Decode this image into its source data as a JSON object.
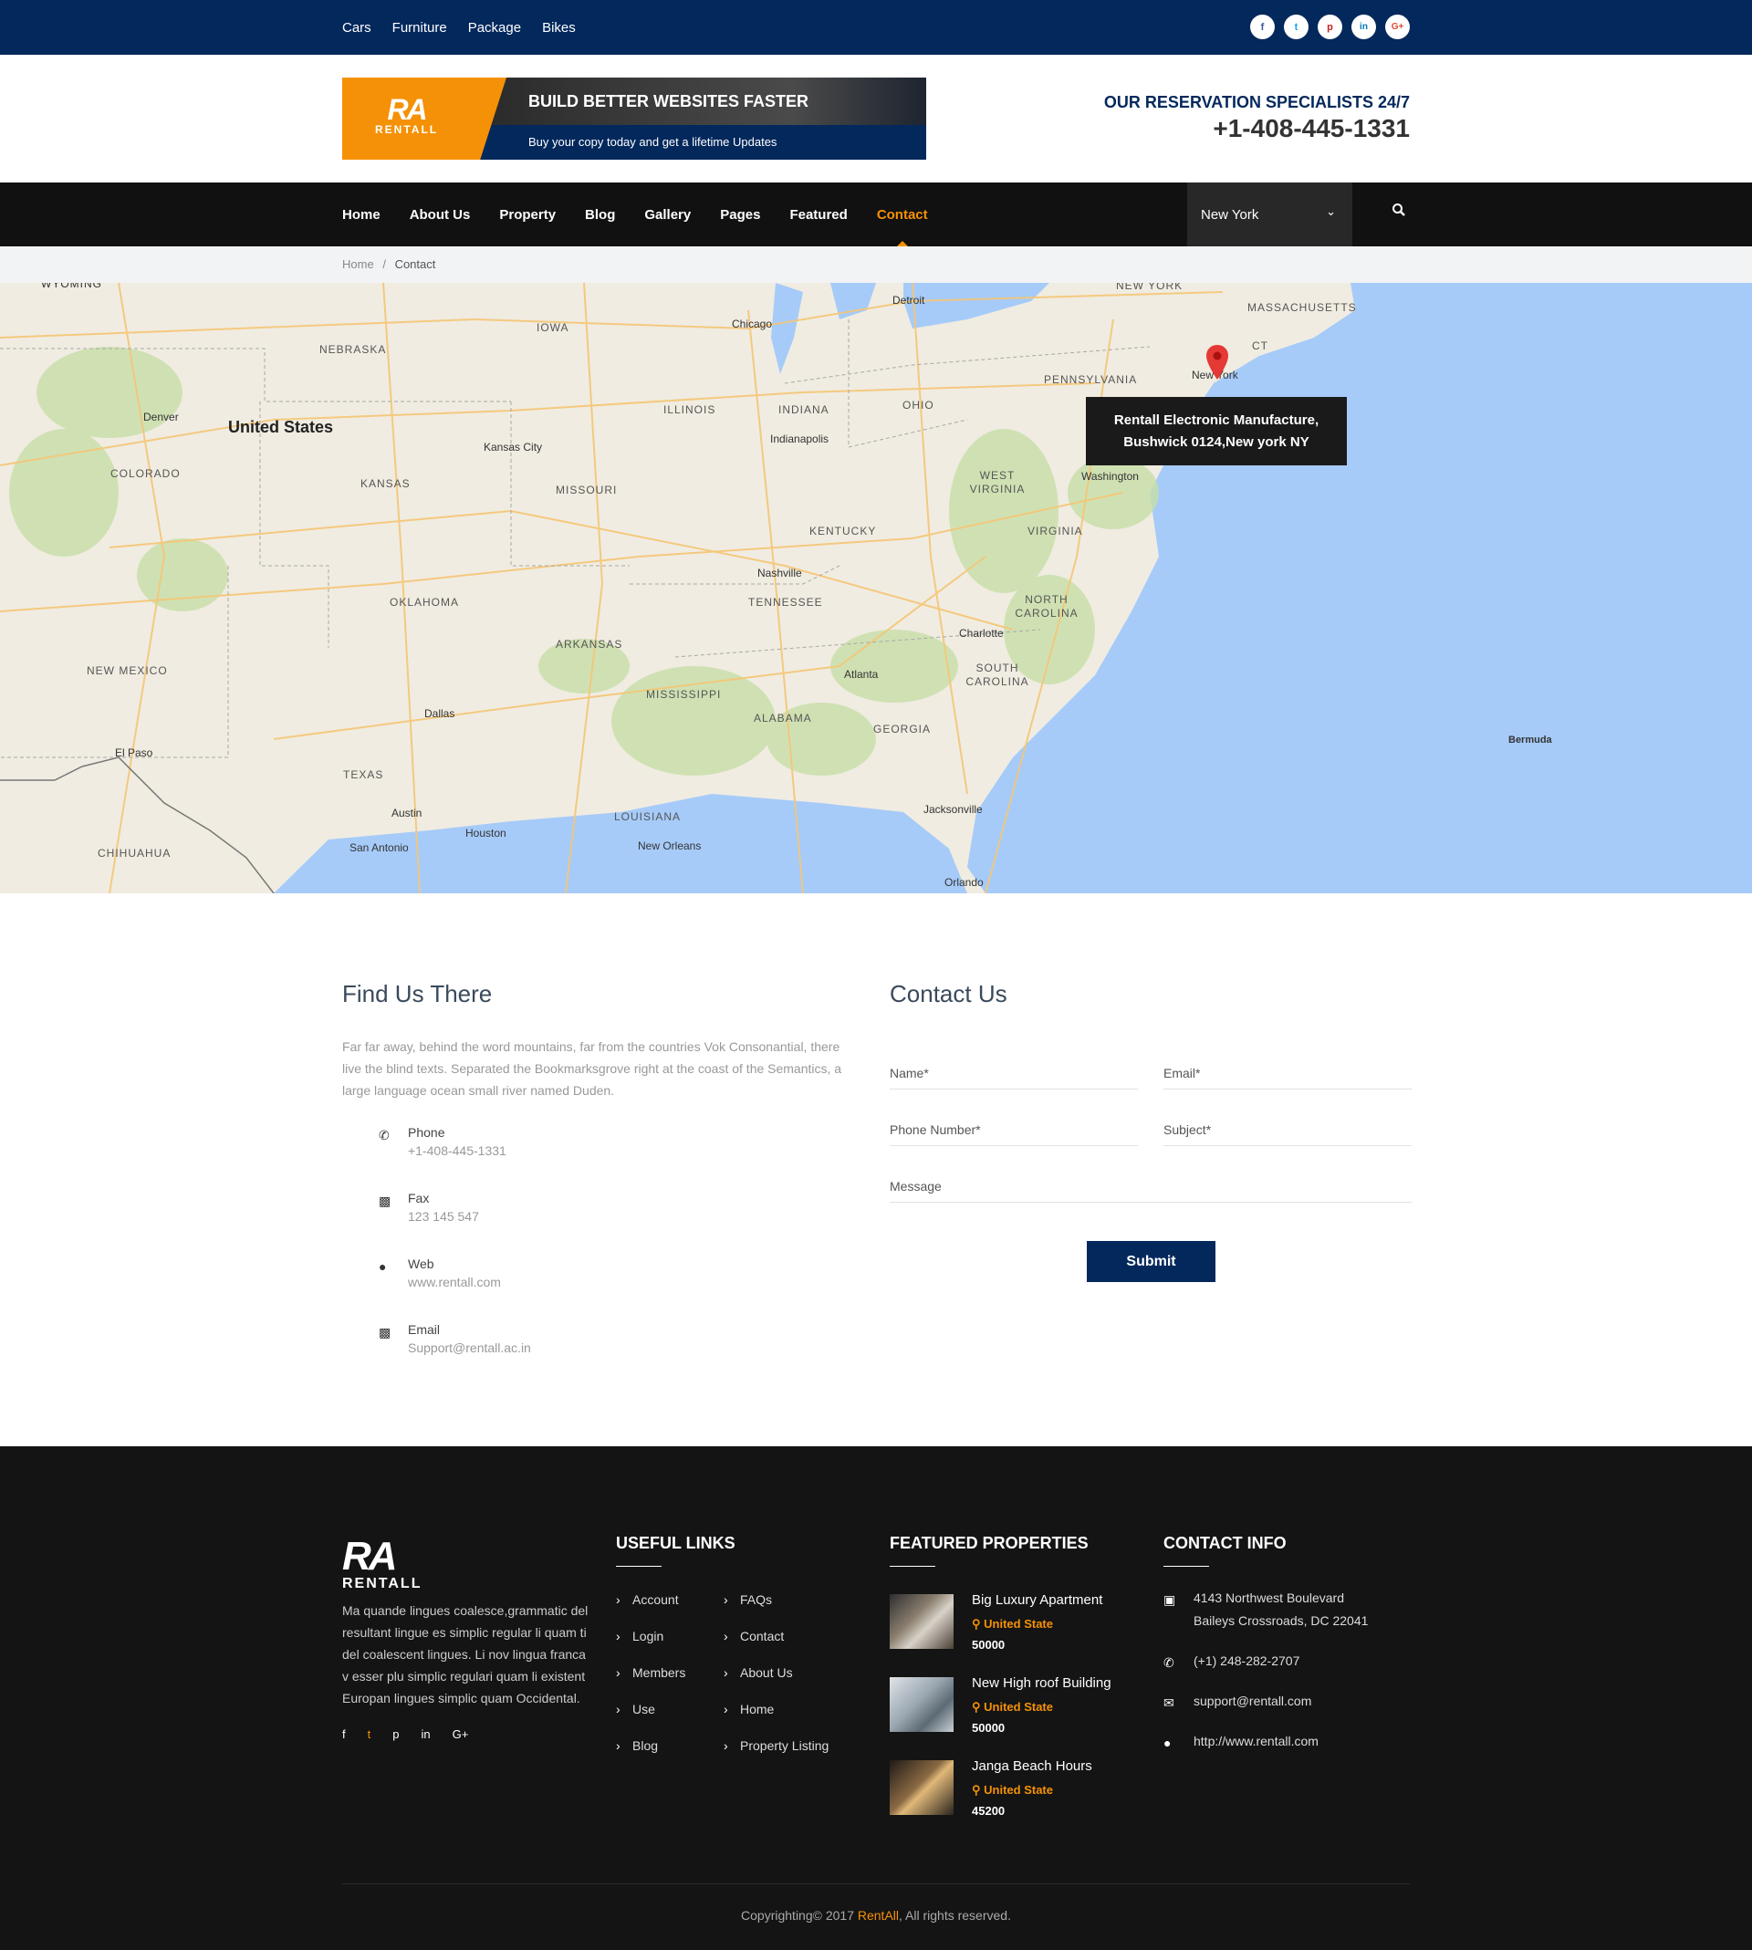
{
  "topbar": {
    "links": [
      "Cars",
      "Furniture",
      "Package",
      "Bikes"
    ],
    "social": [
      {
        "icon": "facebook-icon",
        "glyph": "f",
        "color": "#3b5998"
      },
      {
        "icon": "twitter-icon",
        "glyph": "t",
        "color": "#1da1f2"
      },
      {
        "icon": "pinterest-icon",
        "glyph": "p",
        "color": "#cb2027"
      },
      {
        "icon": "linkedin-icon",
        "glyph": "in",
        "color": "#0077b5"
      },
      {
        "icon": "google-plus-icon",
        "glyph": "G+",
        "color": "#dd4b39"
      }
    ]
  },
  "header": {
    "logo_mark": "RA",
    "logo_word": "RENTALL",
    "banner_title": "BUILD BETTER WEBSITES FASTER",
    "banner_subtitle": "Buy your copy today and get a lifetime Updates",
    "reservation_label": "OUR RESERVATION SPECIALISTS 24/7",
    "reservation_phone": "+1-408-445-1331"
  },
  "nav": {
    "items": [
      "Home",
      "About Us",
      "Property",
      "Blog",
      "Gallery",
      "Pages",
      "Featured",
      "Contact"
    ],
    "active": "Contact",
    "city_select": "New York"
  },
  "breadcrumb": {
    "home": "Home",
    "separator": "/",
    "current": "Contact"
  },
  "map": {
    "infobox_line1": "Rentall Electronic Manufacture,",
    "infobox_line2": "Bushwick 0124,New york NY",
    "country_label": "United States",
    "state_labels": [
      "NEBRASKA",
      "IOWA",
      "ILLINOIS",
      "INDIANA",
      "OHIO",
      "PENNSYLVANIA",
      "NEW YORK",
      "MASSACHUSETTS",
      "CT",
      "COLORADO",
      "KANSAS",
      "MISSOURI",
      "WEST VIRGINIA",
      "VIRGINIA",
      "KENTUCKY",
      "TENNESSEE",
      "NORTH CAROLINA",
      "OKLAHOMA",
      "ARKANSAS",
      "NEW MEXICO",
      "MISSISSIPPI",
      "ALABAMA",
      "GEORGIA",
      "SOUTH CAROLINA",
      "TEXAS",
      "LOUISIANA",
      "CHIHUAHUA",
      "WYOMING"
    ],
    "city_labels": [
      "Detroit",
      "Chicago",
      "Denver",
      "Kansas City",
      "Indianapolis",
      "Washington",
      "Nashville",
      "Charlotte",
      "Atlanta",
      "Dallas",
      "El Paso",
      "Austin",
      "San Antonio",
      "Houston",
      "New Orleans",
      "Jacksonville",
      "Orlando",
      "Bermuda",
      "New York"
    ]
  },
  "find_us": {
    "title": "Find Us There",
    "text": "Far far away, behind the word mountains, far from the countries Vok Consonantial, there live the blind texts. Separated the Bookmarksgrove right at the coast of the Semantics, a large language ocean small river named Duden.",
    "items": [
      {
        "icon": "phone-icon",
        "label": "Phone",
        "value": "+1-408-445-1331"
      },
      {
        "icon": "fax-icon",
        "label": "Fax",
        "value": "123 145 547"
      },
      {
        "icon": "globe-icon",
        "label": "Web",
        "value": "www.rentall.com"
      },
      {
        "icon": "email-icon",
        "label": "Email",
        "value": "Support@rentall.ac.in"
      }
    ]
  },
  "contact_form": {
    "title": "Contact Us",
    "name_placeholder": "Name*",
    "email_placeholder": "Email*",
    "phone_placeholder": "Phone Number*",
    "subject_placeholder": "Subject*",
    "message_placeholder": "Message",
    "submit_label": "Submit"
  },
  "footer": {
    "logo_mark": "RA",
    "logo_word": "RENTALL",
    "about_text": "Ma quande lingues coalesce,grammatic del resultant lingue es simplic regular li quam ti del coalescent lingues. Li nov lingua franca v esser plu simplic regulari quam li existent Europan lingues simplic quam Occidental.",
    "social": [
      "facebook-icon",
      "twitter-icon",
      "pinterest-icon",
      "linkedin-icon",
      "google-plus-icon"
    ],
    "useful_links_title": "USEFUL LINKS",
    "links_col1": [
      "Account",
      "Login",
      "Members",
      "Use",
      "Blog"
    ],
    "links_col2": [
      "FAQs",
      "Contact",
      "About Us",
      "Home",
      "Property Listing"
    ],
    "featured_title": "FEATURED PROPERTIES",
    "properties": [
      {
        "title": "Big Luxury Apartment",
        "location": "United State",
        "price": "50000"
      },
      {
        "title": "New High roof Building",
        "location": "United State",
        "price": "50000"
      },
      {
        "title": "Janga Beach Hours",
        "location": "United State",
        "price": "45200"
      }
    ],
    "contact_title": "CONTACT INFO",
    "address_line1": "4143 Northwest Boulevard",
    "address_line2": "Baileys Crossroads, DC 22041",
    "phone": "(+1) 248-282-2707",
    "email": "support@rentall.com",
    "website": "http://www.rentall.com",
    "copyright_prefix": "Copyrighting© 2017 ",
    "copyright_brand": "RentAll",
    "copyright_suffix": ", All rights reserved."
  },
  "colors": {
    "navy": "#03285c",
    "orange": "#f59106",
    "dark": "#141414",
    "water": "#a6cbf9"
  }
}
